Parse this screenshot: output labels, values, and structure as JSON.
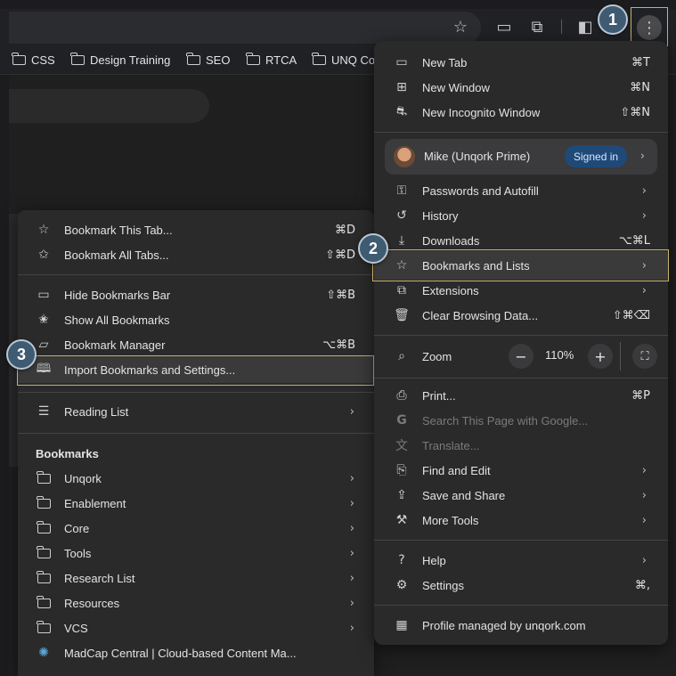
{
  "bookmarks_bar": [
    "CSS",
    "Design Training",
    "SEO",
    "RTCA",
    "UNQ Co"
  ],
  "toolbar_icons": [
    "star-icon",
    "cast-icon",
    "extensions-icon",
    "side-panel-icon",
    "more-icon"
  ],
  "steps": [
    "1",
    "2",
    "3"
  ],
  "colors": {
    "highlight": "#c9b16a",
    "badge": "#3f5b72",
    "menu_bg": "#2a2a2b",
    "signed_badge": "#1f4a78"
  },
  "chrome_menu": {
    "new_tab": {
      "label": "New Tab",
      "shortcut": "⌘T"
    },
    "new_window": {
      "label": "New Window",
      "shortcut": "⌘N"
    },
    "new_incognito": {
      "label": "New Incognito Window",
      "shortcut": "⇧⌘N"
    },
    "profile": {
      "name": "Mike (Unqork Prime)",
      "status": "Signed in"
    },
    "passwords": {
      "label": "Passwords and Autofill"
    },
    "history": {
      "label": "History"
    },
    "downloads": {
      "label": "Downloads",
      "shortcut": "⌥⌘L"
    },
    "bookmarks": {
      "label": "Bookmarks and Lists"
    },
    "extensions": {
      "label": "Extensions"
    },
    "clear_data": {
      "label": "Clear Browsing Data...",
      "shortcut": "⇧⌘⌫"
    },
    "zoom": {
      "label": "Zoom",
      "minus": "−",
      "value": "110%",
      "plus": "+"
    },
    "print": {
      "label": "Print...",
      "shortcut": "⌘P"
    },
    "search_google": {
      "label": "Search This Page with Google..."
    },
    "translate": {
      "label": "Translate..."
    },
    "find_edit": {
      "label": "Find and Edit"
    },
    "save_share": {
      "label": "Save and Share"
    },
    "more_tools": {
      "label": "More Tools"
    },
    "help": {
      "label": "Help"
    },
    "settings": {
      "label": "Settings",
      "shortcut": "⌘,"
    },
    "managed": {
      "label": "Profile managed by unqork.com"
    }
  },
  "bookmarks_menu": {
    "bookmark_tab": {
      "label": "Bookmark This Tab...",
      "shortcut": "⌘D"
    },
    "bookmark_all": {
      "label": "Bookmark All Tabs...",
      "shortcut": "⇧⌘D"
    },
    "hide_bar": {
      "label": "Hide Bookmarks Bar",
      "shortcut": "⇧⌘B"
    },
    "show_all": {
      "label": "Show All Bookmarks"
    },
    "manager": {
      "label": "Bookmark Manager",
      "shortcut": "⌥⌘B"
    },
    "import": {
      "label": "Import Bookmarks and Settings..."
    },
    "reading_list": {
      "label": "Reading List"
    },
    "heading": "Bookmarks",
    "folders": [
      "Unqork",
      "Enablement",
      "Core",
      "Tools",
      "Research List",
      "Resources",
      "VCS"
    ],
    "madcap": {
      "label": "MadCap Central | Cloud-based Content Ma..."
    }
  }
}
